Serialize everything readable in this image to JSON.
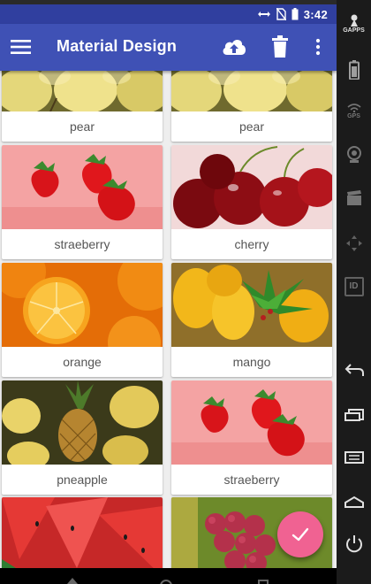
{
  "status_bar": {
    "time": "3:42"
  },
  "app_bar": {
    "title": "Material Design",
    "icons": [
      "menu-icon",
      "cloud-upload-icon",
      "delete-icon",
      "more-vert-icon"
    ]
  },
  "cards": [
    {
      "label": "pear",
      "image": "pear"
    },
    {
      "label": "pear",
      "image": "pear"
    },
    {
      "label": "straeberry",
      "image": "strawberry"
    },
    {
      "label": "cherry",
      "image": "cherry"
    },
    {
      "label": "orange",
      "image": "orange"
    },
    {
      "label": "mango",
      "image": "mango"
    },
    {
      "label": "pneapple",
      "image": "pineapple"
    },
    {
      "label": "straeberry",
      "image": "strawberry"
    },
    {
      "label": "",
      "image": "watermelon"
    },
    {
      "label": "",
      "image": "grapes"
    }
  ],
  "fab": {
    "icon": "check-icon",
    "color": "#f06292"
  },
  "side_panel": {
    "gapps_label": "GAPPS",
    "gps_label": "GPS",
    "id_label": "ID"
  },
  "colors": {
    "primary": "#3f51b5",
    "primary_dark": "#303f9f",
    "accent": "#f06292"
  }
}
